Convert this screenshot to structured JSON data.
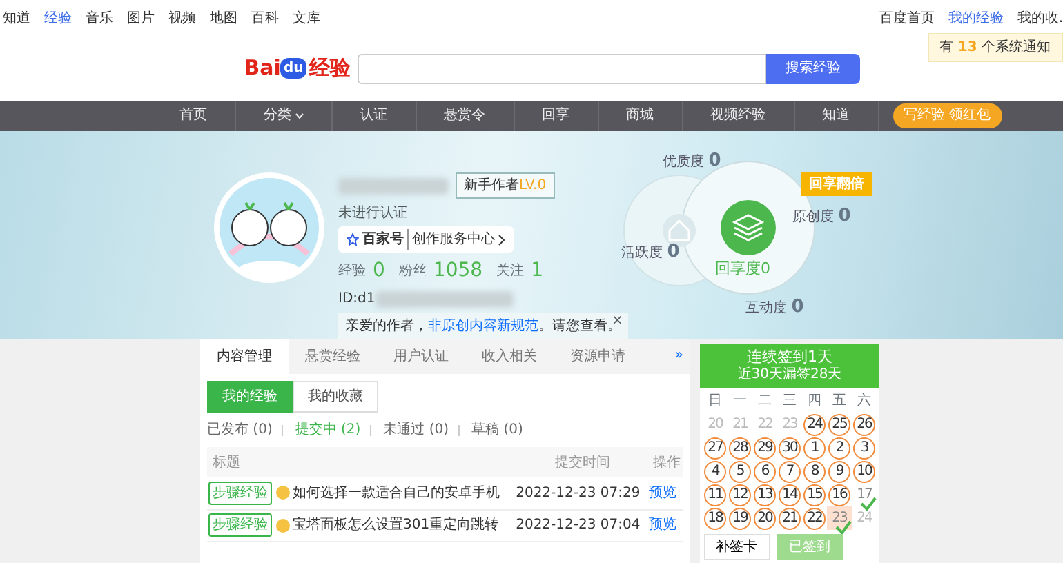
{
  "top_links": [
    {
      "label": "知道",
      "selected": false
    },
    {
      "label": "经验",
      "selected": true
    },
    {
      "label": "音乐",
      "selected": false
    },
    {
      "label": "图片",
      "selected": false
    },
    {
      "label": "视频",
      "selected": false
    },
    {
      "label": "地图",
      "selected": false
    },
    {
      "label": "百科",
      "selected": false
    },
    {
      "label": "文库",
      "selected": false
    }
  ],
  "user_links": [
    {
      "label": "百度首页",
      "selected": false
    },
    {
      "label": "我的经验",
      "selected": true
    },
    {
      "label": "我的收.",
      "selected": false
    }
  ],
  "notification": {
    "prefix": "有",
    "count": "13",
    "suffix": "个系统通知"
  },
  "logo": {
    "text": "Bai",
    "paw": "du",
    "suffix": "经验"
  },
  "search": {
    "button": "搜索经验"
  },
  "nav": [
    {
      "label": "首页",
      "dropdown": false
    },
    {
      "label": "分类",
      "dropdown": true
    },
    {
      "label": "认证",
      "dropdown": false
    },
    {
      "label": "悬赏令",
      "dropdown": false
    },
    {
      "label": "回享",
      "dropdown": false
    },
    {
      "label": "商城",
      "dropdown": false
    },
    {
      "label": "视频经验",
      "dropdown": false
    },
    {
      "label": "知道",
      "dropdown": false
    }
  ],
  "promo": "写经验 领红包",
  "profile": {
    "level_label": "新手作者",
    "level": "LV.0",
    "verification": "未进行认证",
    "service_brand": "百家号",
    "service_label": "创作服务中心",
    "stats": [
      {
        "label": "经验",
        "value": "0"
      },
      {
        "label": "粉丝",
        "value": "1058"
      },
      {
        "label": "关注",
        "value": "1"
      }
    ],
    "id": "ID:d1",
    "notice": {
      "text": "亲爱的作者，",
      "link": "非原创内容新规范",
      "suffix": "。请您查看。",
      "close": "×"
    }
  },
  "metrics": {
    "badge": "回享翻倍",
    "center": {
      "label": "回享度",
      "value": "0"
    },
    "items": [
      {
        "label": "优质度",
        "value": "0"
      },
      {
        "label": "原创度",
        "value": "0"
      },
      {
        "label": "活跃度",
        "value": "0"
      },
      {
        "label": "互动度",
        "value": "0"
      }
    ]
  },
  "tabs": [
    {
      "label": "内容管理",
      "selected": true
    },
    {
      "label": "悬赏经验",
      "selected": false
    },
    {
      "label": "用户认证",
      "selected": false
    },
    {
      "label": "收入相关",
      "selected": false
    },
    {
      "label": "资源申请",
      "selected": false
    }
  ],
  "tabs_more": "»",
  "subtabs": [
    {
      "label": "我的经验",
      "selected": true
    },
    {
      "label": "我的收藏",
      "selected": false
    }
  ],
  "filters": [
    {
      "label": "已发布 (0)",
      "selected": false
    },
    {
      "label": "提交中 (2)",
      "selected": true
    },
    {
      "label": "未通过 (0)",
      "selected": false
    },
    {
      "label": "草稿 (0)",
      "selected": false
    }
  ],
  "table": {
    "columns": [
      "标题",
      "提交时间",
      "操作"
    ],
    "rows": [
      {
        "tag": "步骤经验",
        "title": "如何选择一款适合自己的安卓手机",
        "time": "2022-12-23 07:29",
        "action": "预览"
      },
      {
        "tag": "步骤经验",
        "title": "宝塔面板怎么设置301重定向跳转",
        "time": "2022-12-23 07:04",
        "action": "预览"
      }
    ]
  },
  "calendar": {
    "title": "连续签到1天",
    "subtitle": "近30天漏签28天",
    "weekdays": [
      "日",
      "一",
      "二",
      "三",
      "四",
      "五",
      "六"
    ],
    "days": [
      {
        "day": "20",
        "kind": "outside",
        "today": false
      },
      {
        "day": "21",
        "kind": "outside",
        "today": false
      },
      {
        "day": "22",
        "kind": "outside",
        "today": false
      },
      {
        "day": "23",
        "kind": "outside",
        "today": false
      },
      {
        "day": "24",
        "kind": "missed",
        "today": false
      },
      {
        "day": "25",
        "kind": "missed",
        "today": false
      },
      {
        "day": "26",
        "kind": "missed",
        "today": false
      },
      {
        "day": "27",
        "kind": "missed",
        "today": false
      },
      {
        "day": "28",
        "kind": "missed",
        "today": false
      },
      {
        "day": "29",
        "kind": "missed",
        "today": false
      },
      {
        "day": "30",
        "kind": "missed",
        "today": false
      },
      {
        "day": "1",
        "kind": "missed",
        "today": false
      },
      {
        "day": "2",
        "kind": "missed",
        "today": false
      },
      {
        "day": "3",
        "kind": "missed",
        "today": false
      },
      {
        "day": "4",
        "kind": "missed",
        "today": false
      },
      {
        "day": "5",
        "kind": "missed",
        "today": false
      },
      {
        "day": "6",
        "kind": "missed",
        "today": false
      },
      {
        "day": "7",
        "kind": "missed",
        "today": false
      },
      {
        "day": "8",
        "kind": "missed",
        "today": false
      },
      {
        "day": "9",
        "kind": "missed",
        "today": false
      },
      {
        "day": "10",
        "kind": "missed",
        "today": false
      },
      {
        "day": "11",
        "kind": "missed",
        "today": false
      },
      {
        "day": "12",
        "kind": "missed",
        "today": false
      },
      {
        "day": "13",
        "kind": "missed",
        "today": false
      },
      {
        "day": "14",
        "kind": "missed",
        "today": false
      },
      {
        "day": "15",
        "kind": "missed",
        "today": false
      },
      {
        "day": "16",
        "kind": "missed",
        "today": false
      },
      {
        "day": "17",
        "kind": "signed",
        "today": false
      },
      {
        "day": "18",
        "kind": "missed",
        "today": false
      },
      {
        "day": "19",
        "kind": "missed",
        "today": false
      },
      {
        "day": "20",
        "kind": "missed",
        "today": false
      },
      {
        "day": "21",
        "kind": "missed",
        "today": false
      },
      {
        "day": "22",
        "kind": "missed",
        "today": false
      },
      {
        "day": "23",
        "kind": "signed",
        "today": true
      },
      {
        "day": "24",
        "kind": "future",
        "today": false
      }
    ],
    "buttons": [
      {
        "label": "补签卡",
        "disabled": false
      },
      {
        "label": "已签到",
        "disabled": true
      }
    ]
  }
}
